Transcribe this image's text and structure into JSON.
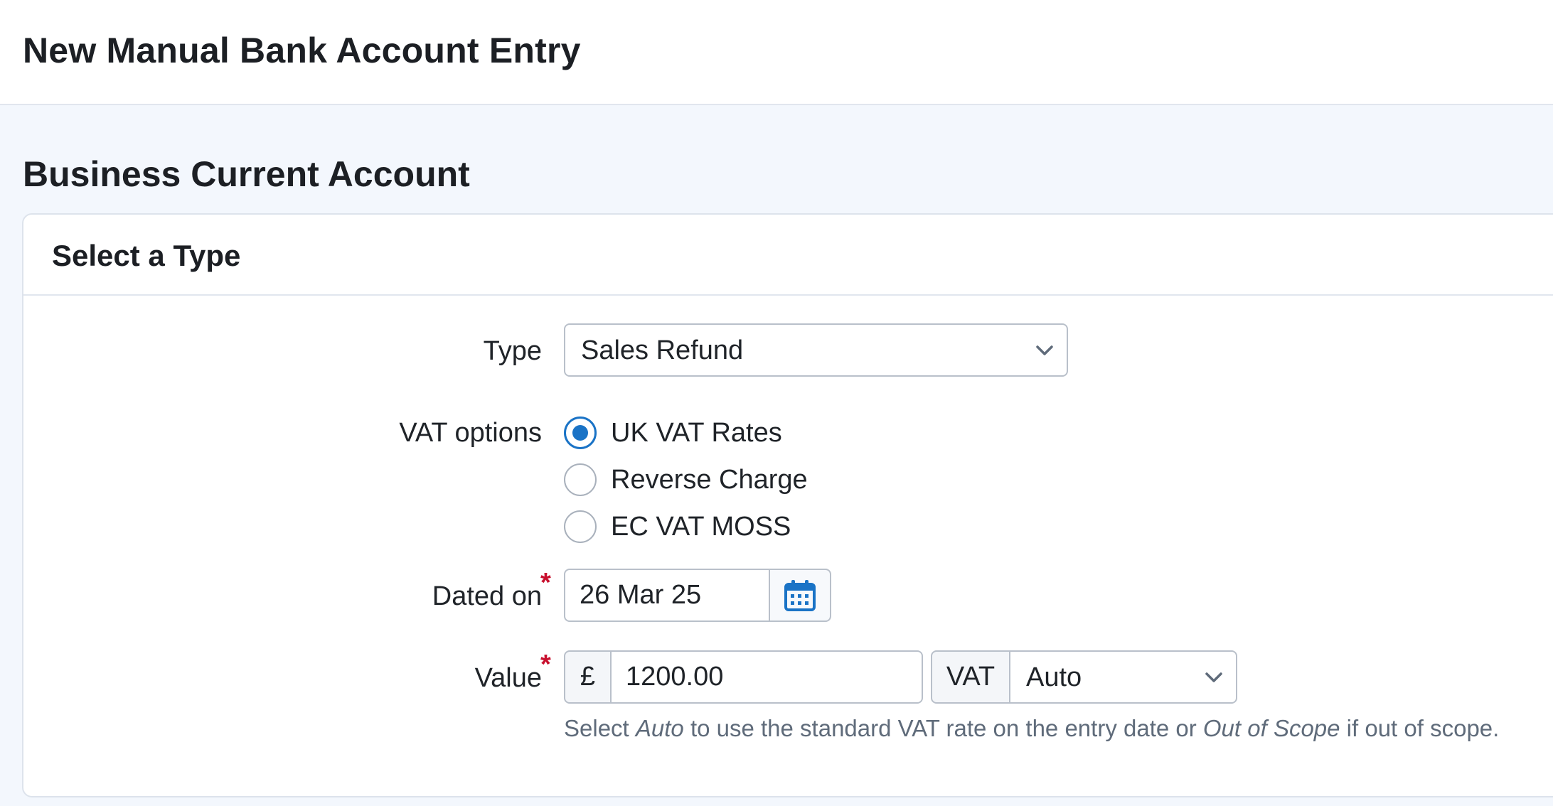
{
  "header": {
    "title": "New Manual Bank Account Entry"
  },
  "account": {
    "title": "Business Current Account"
  },
  "form": {
    "section_title": "Select a Type",
    "type": {
      "label": "Type",
      "value": "Sales Refund"
    },
    "vat_options": {
      "label": "VAT options",
      "options": [
        {
          "label": "UK VAT Rates",
          "checked": true
        },
        {
          "label": "Reverse Charge",
          "checked": false
        },
        {
          "label": "EC VAT MOSS",
          "checked": false
        }
      ]
    },
    "dated_on": {
      "label": "Dated on",
      "required_mark": "*",
      "value": "26 Mar 25"
    },
    "value": {
      "label": "Value",
      "required_mark": "*",
      "currency_symbol": "£",
      "amount": "1200.00",
      "vat_label": "VAT",
      "vat_value": "Auto"
    },
    "help": {
      "part1": "Select ",
      "em1": "Auto",
      "part2": " to use the standard VAT rate on the entry date or ",
      "em2": "Out of Scope",
      "part3": " if out of scope."
    }
  },
  "colors": {
    "accent": "#1a73c6",
    "required": "#c8102e",
    "page_bg": "#f3f7fd",
    "border": "#b9c0ca"
  },
  "icons": {
    "date_picker": "calendar-icon",
    "dropdown": "chevron-down-icon"
  }
}
